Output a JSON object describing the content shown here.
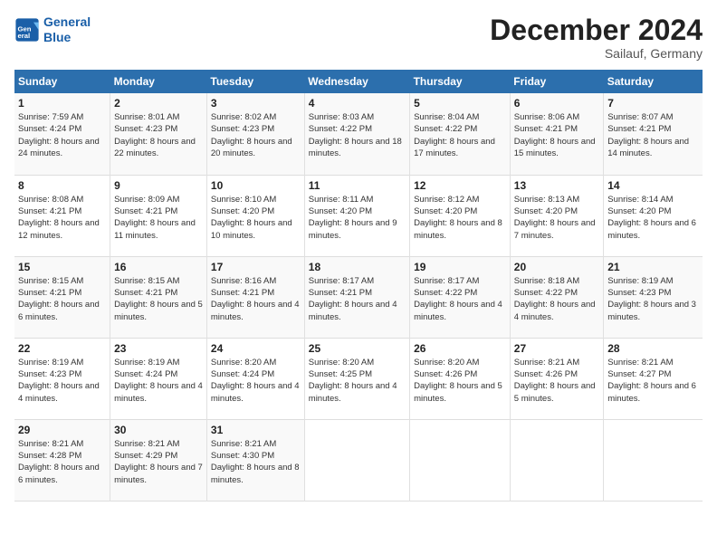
{
  "header": {
    "logo_line1": "General",
    "logo_line2": "Blue",
    "month_title": "December 2024",
    "subtitle": "Sailauf, Germany"
  },
  "weekdays": [
    "Sunday",
    "Monday",
    "Tuesday",
    "Wednesday",
    "Thursday",
    "Friday",
    "Saturday"
  ],
  "weeks": [
    [
      {
        "day": "1",
        "sunrise": "7:59 AM",
        "sunset": "4:24 PM",
        "daylight": "8 hours and 24 minutes."
      },
      {
        "day": "2",
        "sunrise": "8:01 AM",
        "sunset": "4:23 PM",
        "daylight": "8 hours and 22 minutes."
      },
      {
        "day": "3",
        "sunrise": "8:02 AM",
        "sunset": "4:23 PM",
        "daylight": "8 hours and 20 minutes."
      },
      {
        "day": "4",
        "sunrise": "8:03 AM",
        "sunset": "4:22 PM",
        "daylight": "8 hours and 18 minutes."
      },
      {
        "day": "5",
        "sunrise": "8:04 AM",
        "sunset": "4:22 PM",
        "daylight": "8 hours and 17 minutes."
      },
      {
        "day": "6",
        "sunrise": "8:06 AM",
        "sunset": "4:21 PM",
        "daylight": "8 hours and 15 minutes."
      },
      {
        "day": "7",
        "sunrise": "8:07 AM",
        "sunset": "4:21 PM",
        "daylight": "8 hours and 14 minutes."
      }
    ],
    [
      {
        "day": "8",
        "sunrise": "8:08 AM",
        "sunset": "4:21 PM",
        "daylight": "8 hours and 12 minutes."
      },
      {
        "day": "9",
        "sunrise": "8:09 AM",
        "sunset": "4:21 PM",
        "daylight": "8 hours and 11 minutes."
      },
      {
        "day": "10",
        "sunrise": "8:10 AM",
        "sunset": "4:20 PM",
        "daylight": "8 hours and 10 minutes."
      },
      {
        "day": "11",
        "sunrise": "8:11 AM",
        "sunset": "4:20 PM",
        "daylight": "8 hours and 9 minutes."
      },
      {
        "day": "12",
        "sunrise": "8:12 AM",
        "sunset": "4:20 PM",
        "daylight": "8 hours and 8 minutes."
      },
      {
        "day": "13",
        "sunrise": "8:13 AM",
        "sunset": "4:20 PM",
        "daylight": "8 hours and 7 minutes."
      },
      {
        "day": "14",
        "sunrise": "8:14 AM",
        "sunset": "4:20 PM",
        "daylight": "8 hours and 6 minutes."
      }
    ],
    [
      {
        "day": "15",
        "sunrise": "8:15 AM",
        "sunset": "4:21 PM",
        "daylight": "8 hours and 6 minutes."
      },
      {
        "day": "16",
        "sunrise": "8:15 AM",
        "sunset": "4:21 PM",
        "daylight": "8 hours and 5 minutes."
      },
      {
        "day": "17",
        "sunrise": "8:16 AM",
        "sunset": "4:21 PM",
        "daylight": "8 hours and 4 minutes."
      },
      {
        "day": "18",
        "sunrise": "8:17 AM",
        "sunset": "4:21 PM",
        "daylight": "8 hours and 4 minutes."
      },
      {
        "day": "19",
        "sunrise": "8:17 AM",
        "sunset": "4:22 PM",
        "daylight": "8 hours and 4 minutes."
      },
      {
        "day": "20",
        "sunrise": "8:18 AM",
        "sunset": "4:22 PM",
        "daylight": "8 hours and 4 minutes."
      },
      {
        "day": "21",
        "sunrise": "8:19 AM",
        "sunset": "4:23 PM",
        "daylight": "8 hours and 3 minutes."
      }
    ],
    [
      {
        "day": "22",
        "sunrise": "8:19 AM",
        "sunset": "4:23 PM",
        "daylight": "8 hours and 4 minutes."
      },
      {
        "day": "23",
        "sunrise": "8:19 AM",
        "sunset": "4:24 PM",
        "daylight": "8 hours and 4 minutes."
      },
      {
        "day": "24",
        "sunrise": "8:20 AM",
        "sunset": "4:24 PM",
        "daylight": "8 hours and 4 minutes."
      },
      {
        "day": "25",
        "sunrise": "8:20 AM",
        "sunset": "4:25 PM",
        "daylight": "8 hours and 4 minutes."
      },
      {
        "day": "26",
        "sunrise": "8:20 AM",
        "sunset": "4:26 PM",
        "daylight": "8 hours and 5 minutes."
      },
      {
        "day": "27",
        "sunrise": "8:21 AM",
        "sunset": "4:26 PM",
        "daylight": "8 hours and 5 minutes."
      },
      {
        "day": "28",
        "sunrise": "8:21 AM",
        "sunset": "4:27 PM",
        "daylight": "8 hours and 6 minutes."
      }
    ],
    [
      {
        "day": "29",
        "sunrise": "8:21 AM",
        "sunset": "4:28 PM",
        "daylight": "8 hours and 6 minutes."
      },
      {
        "day": "30",
        "sunrise": "8:21 AM",
        "sunset": "4:29 PM",
        "daylight": "8 hours and 7 minutes."
      },
      {
        "day": "31",
        "sunrise": "8:21 AM",
        "sunset": "4:30 PM",
        "daylight": "8 hours and 8 minutes."
      },
      null,
      null,
      null,
      null
    ]
  ],
  "labels": {
    "sunrise": "Sunrise:",
    "sunset": "Sunset:",
    "daylight": "Daylight:"
  }
}
